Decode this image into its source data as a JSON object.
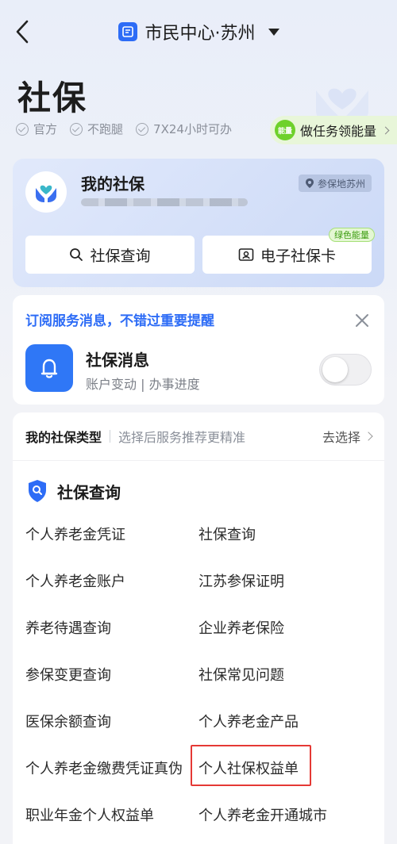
{
  "header": {
    "title": "市民中心·苏州"
  },
  "page": {
    "title": "社保"
  },
  "features": [
    "官方",
    "不跑腿",
    "7X24小时可办"
  ],
  "energy_task": {
    "badge": "能量",
    "label": "做任务领能量"
  },
  "my_card": {
    "title": "我的社保",
    "location": "参保地苏州",
    "buttons": {
      "query": "社保查询",
      "card": "电子社保卡",
      "card_tag": "绿色能量"
    }
  },
  "subscription": {
    "heading": "订阅服务消息，不错过重要提醒",
    "title": "社保消息",
    "desc": "账户变动 | 办事进度"
  },
  "services": {
    "type_label": "我的社保类型",
    "type_hint": "选择后服务推荐更精准",
    "type_action": "去选择",
    "section_title": "社保查询",
    "items": [
      "个人养老金凭证",
      "社保查询",
      "个人养老金账户",
      "江苏参保证明",
      "养老待遇查询",
      "企业养老保险",
      "参保变更查询",
      "社保常见问题",
      "医保余额查询",
      "个人养老金产品",
      "个人养老金缴费凭证真伪",
      "个人社保权益单",
      "职业年金个人权益单",
      "个人养老金开通城市"
    ]
  }
}
